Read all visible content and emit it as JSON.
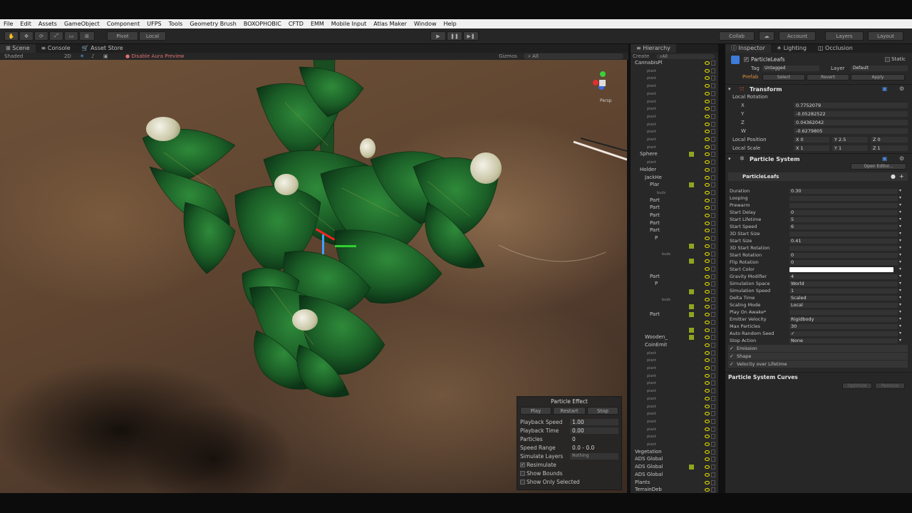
{
  "menu": [
    "File",
    "Edit",
    "Assets",
    "GameObject",
    "Component",
    "UFPS",
    "Tools",
    "Geometry Brush",
    "BOXOPHOBIC",
    "CFTD",
    "EMM",
    "Mobile Input",
    "Atlas Maker",
    "Window",
    "Help"
  ],
  "toolbar": {
    "pivot": "Pivot",
    "local": "Local",
    "collab": "Collab",
    "account": "Account",
    "layers": "Layers",
    "layout": "Layout"
  },
  "scene_tabs": {
    "scene": "Scene",
    "console": "Console",
    "asset_store": "Asset Store"
  },
  "scene_bar": {
    "shaded": "Shaded",
    "mode_2d": "2D",
    "aura": "Disable Aura Preview",
    "gizmos": "Gizmos",
    "search": "All"
  },
  "gizmo_persp": "Persp",
  "hierarchy": {
    "tab": "Hierarchy",
    "create": "Create",
    "search": "All",
    "rows": [
      {
        "name": "CannabisPl",
        "indent": 0,
        "grid": false
      },
      {
        "name": "",
        "sub": "plant",
        "indent": 1
      },
      {
        "name": "",
        "sub": "plant",
        "indent": 1
      },
      {
        "name": "",
        "sub": "plant",
        "indent": 1
      },
      {
        "name": "",
        "sub": "plant",
        "indent": 1
      },
      {
        "name": "",
        "sub": "plant",
        "indent": 1
      },
      {
        "name": "",
        "sub": "plant",
        "indent": 1
      },
      {
        "name": "",
        "sub": "plant",
        "indent": 1
      },
      {
        "name": "",
        "sub": "plant",
        "indent": 1
      },
      {
        "name": "",
        "sub": "plant",
        "indent": 1
      },
      {
        "name": "",
        "sub": "plant",
        "indent": 1
      },
      {
        "name": "",
        "sub": "plant",
        "indent": 1
      },
      {
        "name": "Sphere",
        "indent": 1,
        "grid": true
      },
      {
        "name": "",
        "sub": "plant",
        "indent": 1
      },
      {
        "name": "Holder",
        "indent": 1
      },
      {
        "name": "JackHe",
        "indent": 2
      },
      {
        "name": "Plar",
        "indent": 3,
        "grid": true
      },
      {
        "name": "",
        "sub": "buds",
        "indent": 3
      },
      {
        "name": "Part",
        "indent": 3
      },
      {
        "name": "Part",
        "indent": 3
      },
      {
        "name": "Part",
        "indent": 3
      },
      {
        "name": "Part",
        "indent": 3
      },
      {
        "name": "Part",
        "indent": 3
      },
      {
        "name": "P",
        "indent": 4
      },
      {
        "name": "",
        "sub": "",
        "indent": 4,
        "grid": true
      },
      {
        "name": "",
        "sub": "buds",
        "indent": 4
      },
      {
        "name": "",
        "sub": "",
        "indent": 4,
        "grid": true
      },
      {
        "name": "",
        "sub": "",
        "indent": 4
      },
      {
        "name": "Part",
        "indent": 3
      },
      {
        "name": "P",
        "indent": 4
      },
      {
        "name": "",
        "sub": "",
        "indent": 4,
        "grid": true
      },
      {
        "name": "",
        "sub": "buds",
        "indent": 4
      },
      {
        "name": "",
        "sub": "",
        "indent": 4,
        "grid": true
      },
      {
        "name": "Part",
        "indent": 3,
        "grid": true
      },
      {
        "name": "",
        "sub": "",
        "indent": 3
      },
      {
        "name": "",
        "sub": "",
        "indent": 2,
        "grid": true
      },
      {
        "name": "Wooden_",
        "indent": 2,
        "grid": true
      },
      {
        "name": "CoinEmit",
        "indent": 2
      },
      {
        "name": "",
        "sub": "plant",
        "indent": 1
      },
      {
        "name": "",
        "sub": "plant",
        "indent": 1
      },
      {
        "name": "",
        "sub": "plant",
        "indent": 1
      },
      {
        "name": "",
        "sub": "plant",
        "indent": 1
      },
      {
        "name": "",
        "sub": "plant",
        "indent": 1
      },
      {
        "name": "",
        "sub": "plant",
        "indent": 1
      },
      {
        "name": "",
        "sub": "plant",
        "indent": 1
      },
      {
        "name": "",
        "sub": "plant",
        "indent": 1
      },
      {
        "name": "",
        "sub": "plant",
        "indent": 1
      },
      {
        "name": "",
        "sub": "plant",
        "indent": 1
      },
      {
        "name": "",
        "sub": "plant",
        "indent": 1
      },
      {
        "name": "",
        "sub": "plant",
        "indent": 1
      },
      {
        "name": "",
        "sub": "plant",
        "indent": 1
      },
      {
        "name": "Vegetation",
        "indent": 0
      },
      {
        "name": "ADS Global",
        "indent": 0
      },
      {
        "name": "ADS Global",
        "indent": 0,
        "grid": true
      },
      {
        "name": "ADS Global",
        "indent": 0
      },
      {
        "name": "Plants",
        "indent": 0
      },
      {
        "name": "TerrainDeb",
        "indent": 0
      }
    ]
  },
  "inspector": {
    "tabs": {
      "inspector": "Inspector",
      "lighting": "Lighting",
      "occlusion": "Occlusion"
    },
    "object_name": "ParticleLeafs",
    "static": "Static",
    "tag_label": "Tag",
    "tag_value": "Untagged",
    "layer_label": "Layer",
    "layer_value": "Default",
    "prefab_label": "Prefab",
    "prefab_select": "Select",
    "prefab_revert": "Revert",
    "prefab_apply": "Apply",
    "transform": "Transform",
    "local_rotation": "Local Rotation",
    "rot_x": "X",
    "rot_x_val": "0.7752079",
    "rot_y": "Y",
    "rot_y_val": "-0.05282522",
    "rot_z": "Z",
    "rot_z_val": "0.04362042",
    "rot_w": "W",
    "rot_w_val": "-0.6279805",
    "local_position": "Local Position",
    "pos_x": "X 0",
    "pos_y": "Y 2.5",
    "pos_z": "Z 0",
    "local_scale": "Local Scale",
    "scl_x": "X 1",
    "scl_y": "Y 1",
    "scl_z": "Z 1",
    "particle_system": "Particle System",
    "open_editor": "Open Editor...",
    "module_name": "ParticleLeafs",
    "props": [
      {
        "label": "Duration",
        "value": "0.30"
      },
      {
        "label": "Looping",
        "value": ""
      },
      {
        "label": "Prewarm",
        "value": ""
      },
      {
        "label": "Start Delay",
        "value": "0"
      },
      {
        "label": "Start Lifetime",
        "value": "5"
      },
      {
        "label": "Start Speed",
        "value": "6"
      },
      {
        "label": "3D Start Size",
        "value": ""
      },
      {
        "label": "Start Size",
        "value": "0.41"
      },
      {
        "label": "3D Start Rotation",
        "value": ""
      },
      {
        "label": "Start Rotation",
        "value": "0"
      },
      {
        "label": "Flip Rotation",
        "value": "0"
      },
      {
        "label": "Start Color",
        "value": ""
      },
      {
        "label": "Gravity Modifier",
        "value": "4"
      },
      {
        "label": "Simulation Space",
        "value": "World"
      },
      {
        "label": "Simulation Speed",
        "value": "1"
      },
      {
        "label": "Delta Time",
        "value": "Scaled"
      },
      {
        "label": "Scaling Mode",
        "value": "Local"
      },
      {
        "label": "Play On Awake*",
        "value": ""
      },
      {
        "label": "Emitter Velocity",
        "value": "Rigidbody"
      },
      {
        "label": "Max Particles",
        "value": "30"
      },
      {
        "label": "Auto Random Seed",
        "value": "✓"
      },
      {
        "label": "Stop Action",
        "value": "None"
      }
    ],
    "modules": [
      "Emission",
      "Shape",
      "Velocity over Lifetime"
    ],
    "curves_title": "Particle System Curves",
    "optimize": "Optimize",
    "remove": "Remove"
  },
  "particle_effect": {
    "title": "Particle Effect",
    "play": "Play",
    "restart": "Restart",
    "stop": "Stop",
    "rows": [
      {
        "label": "Playback Speed",
        "value": "1.00"
      },
      {
        "label": "Playback Time",
        "value": "0.00"
      },
      {
        "label": "Particles",
        "value": "0"
      },
      {
        "label": "Speed Range",
        "value": "0.0 - 0.0"
      },
      {
        "label": "Simulate Layers",
        "value": "Nothing"
      }
    ],
    "resimulate": "Resimulate",
    "show_bounds": "Show Bounds",
    "show_only_selected": "Show Only Selected"
  },
  "colors": {
    "accent": "#e8e200",
    "scene_soil": "#6e5138",
    "leaf": "#1f6b2e",
    "panel": "#282828"
  }
}
